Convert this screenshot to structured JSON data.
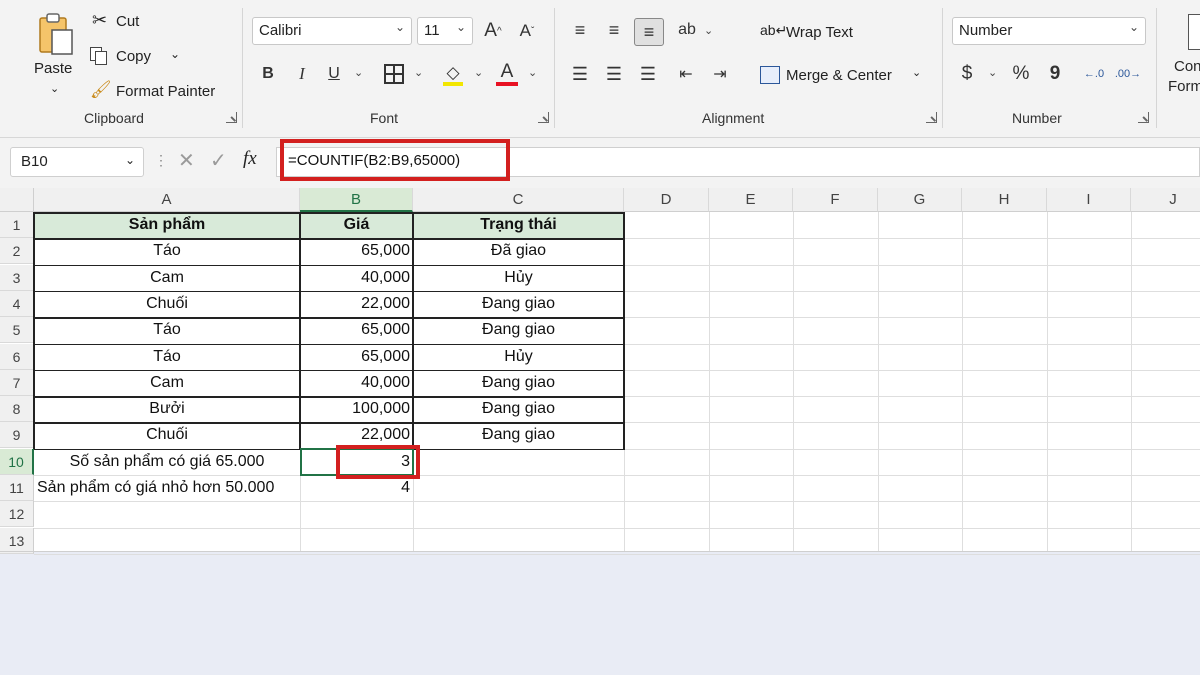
{
  "ribbon": {
    "clipboard": {
      "paste": "Paste",
      "cut": "Cut",
      "copy": "Copy",
      "format_painter": "Format Painter",
      "label": "Clipboard"
    },
    "font": {
      "name": "Calibri",
      "size": "11",
      "bold": "B",
      "italic": "I",
      "underline": "U",
      "font_color_letter": "A",
      "label": "Font",
      "accent_fill": "#f2e600",
      "accent_font": "#e81123"
    },
    "alignment": {
      "wrap_text": "Wrap Text",
      "merge_center": "Merge & Center",
      "label": "Alignment"
    },
    "number": {
      "format": "Number",
      "currency": "$",
      "percent": "%",
      "comma": "9",
      "label": "Number"
    },
    "styles": {
      "line1": "Con",
      "line2": "Form"
    }
  },
  "formula_bar": {
    "name_box": "B10",
    "fx": "fx",
    "formula": "=COUNTIF(B2:B9,65000)"
  },
  "columns": [
    "A",
    "B",
    "C",
    "D",
    "E",
    "F",
    "G",
    "H",
    "I",
    "J"
  ],
  "rows": [
    "1",
    "2",
    "3",
    "4",
    "5",
    "6",
    "7",
    "8",
    "9",
    "10",
    "11",
    "12",
    "13"
  ],
  "table": {
    "headers": [
      "Sản phẩm",
      "Giá",
      "Trạng thái"
    ],
    "rows": [
      [
        "Táo",
        "65,000",
        "Đã giao"
      ],
      [
        "Cam",
        "40,000",
        "Hủy"
      ],
      [
        "Chuối",
        "22,000",
        "Đang giao"
      ],
      [
        "Táo",
        "65,000",
        "Đang giao"
      ],
      [
        "Táo",
        "65,000",
        "Hủy"
      ],
      [
        "Cam",
        "40,000",
        "Đang giao"
      ],
      [
        "Bưởi",
        "100,000",
        "Đang giao"
      ],
      [
        "Chuối",
        "22,000",
        "Đang giao"
      ]
    ]
  },
  "summary": [
    {
      "label": "Số sản phẩm có giá 65.000",
      "value": "3"
    },
    {
      "label": "Sản phẩm có giá  nhỏ hơn 50.000",
      "value": "4"
    }
  ],
  "colors": {
    "highlight_red": "#d3201f",
    "header_fill": "#d8ead9",
    "excel_green": "#217346"
  }
}
